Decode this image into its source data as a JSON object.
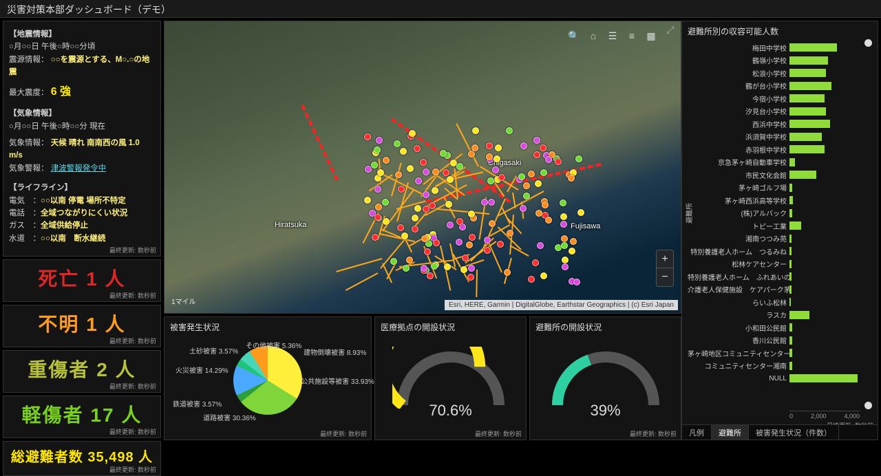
{
  "title": "災害対策本部ダッシュボード（デモ）",
  "updated_label": "最終更新: 数秒前",
  "info_panel": {
    "eq_head": "【地震情報】",
    "eq_time": "○月○○日 午後○時○○分頃",
    "eq_src_label": "震源情報：",
    "eq_src_val": "○○を震源とする、M○.○の地震",
    "eq_max_label": "最大震度：",
    "eq_max_val": "6 強",
    "wx_head": "【気象情報】",
    "wx_time": "○月○○日 午後○時○○分 現在",
    "wx_label": "気象情報：",
    "wx_val": "天候 晴れ 南南西の風 1.0 m/s",
    "wx_warn_label": "気象警報：",
    "wx_warn_val": "津波警報発令中",
    "ll_head": "【ライフライン】",
    "ll_elec_l": "電気　：",
    "ll_elec_v": "○○以南 停電 場所不特定",
    "ll_tel_l": "電話　：",
    "ll_tel_v": "全域つながりにくい状況",
    "ll_gas_l": "ガス　：",
    "ll_gas_v": "全域供給停止",
    "ll_water_l": "水道　：",
    "ll_water_v": "○○以南　断水継続"
  },
  "stats": {
    "dead": {
      "label": "死亡 1 人"
    },
    "missing": {
      "label": "不明 1 人"
    },
    "severe": {
      "label": "重傷者 2 人"
    },
    "minor": {
      "label": "軽傷者 17 人"
    },
    "evac": {
      "label": "総避難者数 35,498 人"
    }
  },
  "map": {
    "labels": {
      "hiratsuka": "Hiratsuka",
      "chigasaki": "Chigasaki",
      "fujisawa": "Fujisawa"
    },
    "scale": "1マイル",
    "attrib": "Esri, HERE, Garmin | DigitalGlobe, Earthstar Geographics | (c) Esri Japan"
  },
  "pie": {
    "title": "被害発生状況",
    "labels": {
      "public": "公共施設等被害 33.93%",
      "road": "道路被害 30.36%",
      "rail": "鉄道被害 3.57%",
      "fire": "火災被害 14.29%",
      "soil": "土砂被害 3.57%",
      "other": "その他被害 5.36%",
      "building": "建物倒壊被害 8.93%"
    }
  },
  "gauge1": {
    "title": "医療拠点の開設状況",
    "value": "70.6%",
    "pct": 70.6,
    "color": "#ffe61a"
  },
  "gauge2": {
    "title": "避難所の開設状況",
    "value": "39%",
    "pct": 39,
    "color": "#2ecfa0"
  },
  "barchart": {
    "title": "避難所別の収容可能人数",
    "ylabel": "避難所",
    "xticks": [
      "0",
      "2,000",
      "4,000"
    ],
    "max": 4500,
    "rows": [
      {
        "name": "梅田中学校",
        "v": 2600
      },
      {
        "name": "鶴嶺小学校",
        "v": 2100
      },
      {
        "name": "松浪小学校",
        "v": 2000
      },
      {
        "name": "鶴が台小学校",
        "v": 2300
      },
      {
        "name": "今宿小学校",
        "v": 1900
      },
      {
        "name": "汐見台小学校",
        "v": 2000
      },
      {
        "name": "西浜中学校",
        "v": 2200
      },
      {
        "name": "浜須賀中学校",
        "v": 1750
      },
      {
        "name": "赤羽根中学校",
        "v": 1900
      },
      {
        "name": "京急茅ヶ崎自動車学校",
        "v": 300
      },
      {
        "name": "市民文化会館",
        "v": 1450
      },
      {
        "name": "茅ヶ崎ゴルフ場",
        "v": 150
      },
      {
        "name": "茅ヶ崎西浜高等学校",
        "v": 200
      },
      {
        "name": "(株)アルバック",
        "v": 150
      },
      {
        "name": "トピー工業",
        "v": 650
      },
      {
        "name": "湘南つつみ苑",
        "v": 100
      },
      {
        "name": "特別養護老人ホーム　つるみね",
        "v": 120
      },
      {
        "name": "松林ケアセンター",
        "v": 100
      },
      {
        "name": "特別養護老人ホーム　ふれあいの森",
        "v": 120
      },
      {
        "name": "介護老人保健施設　ケアパーク茅ヶ崎",
        "v": 120
      },
      {
        "name": "らいふ松林",
        "v": 90
      },
      {
        "name": "ラスカ",
        "v": 1100
      },
      {
        "name": "小和田公民館",
        "v": 160
      },
      {
        "name": "香川公民館",
        "v": 160
      },
      {
        "name": "茅ヶ崎地区コミュニティセンター",
        "v": 140
      },
      {
        "name": "コミュニティセンター湘南",
        "v": 140
      },
      {
        "name": "NULL",
        "v": 3700
      }
    ]
  },
  "tabs": {
    "legend": "凡例",
    "shelter": "避難所",
    "damage": "被害発生状況（件数）"
  },
  "chart_data": [
    {
      "type": "pie",
      "title": "被害発生状況",
      "series": [
        {
          "name": "公共施設等被害",
          "value": 33.93
        },
        {
          "name": "道路被害",
          "value": 30.36
        },
        {
          "name": "鉄道被害",
          "value": 3.57
        },
        {
          "name": "火災被害",
          "value": 14.29
        },
        {
          "name": "土砂被害",
          "value": 3.57
        },
        {
          "name": "その他被害",
          "value": 5.36
        },
        {
          "name": "建物倒壊被害",
          "value": 8.93
        }
      ]
    },
    {
      "type": "gauge",
      "title": "医療拠点の開設状況",
      "value": 70.6,
      "range": [
        0,
        100
      ]
    },
    {
      "type": "gauge",
      "title": "避難所の開設状況",
      "value": 39,
      "range": [
        0,
        100
      ]
    },
    {
      "type": "bar",
      "title": "避難所別の収容可能人数",
      "xlabel": "",
      "ylabel": "避難所",
      "xlim": [
        0,
        4500
      ],
      "categories": [
        "梅田中学校",
        "鶴嶺小学校",
        "松浪小学校",
        "鶴が台小学校",
        "今宿小学校",
        "汐見台小学校",
        "西浜中学校",
        "浜須賀中学校",
        "赤羽根中学校",
        "京急茅ヶ崎自動車学校",
        "市民文化会館",
        "茅ヶ崎ゴルフ場",
        "茅ヶ崎西浜高等学校",
        "(株)アルバック",
        "トピー工業",
        "湘南つつみ苑",
        "特別養護老人ホーム　つるみね",
        "松林ケアセンター",
        "特別養護老人ホーム　ふれあいの森",
        "介護老人保健施設　ケアパーク茅ヶ崎",
        "らいふ松林",
        "ラスカ",
        "小和田公民館",
        "香川公民館",
        "茅ヶ崎地区コミュニティセンター",
        "コミュニティセンター湘南",
        "NULL"
      ],
      "values": [
        2600,
        2100,
        2000,
        2300,
        1900,
        2000,
        2200,
        1750,
        1900,
        300,
        1450,
        150,
        200,
        150,
        650,
        100,
        120,
        100,
        120,
        120,
        90,
        1100,
        160,
        160,
        140,
        140,
        3700
      ]
    }
  ]
}
